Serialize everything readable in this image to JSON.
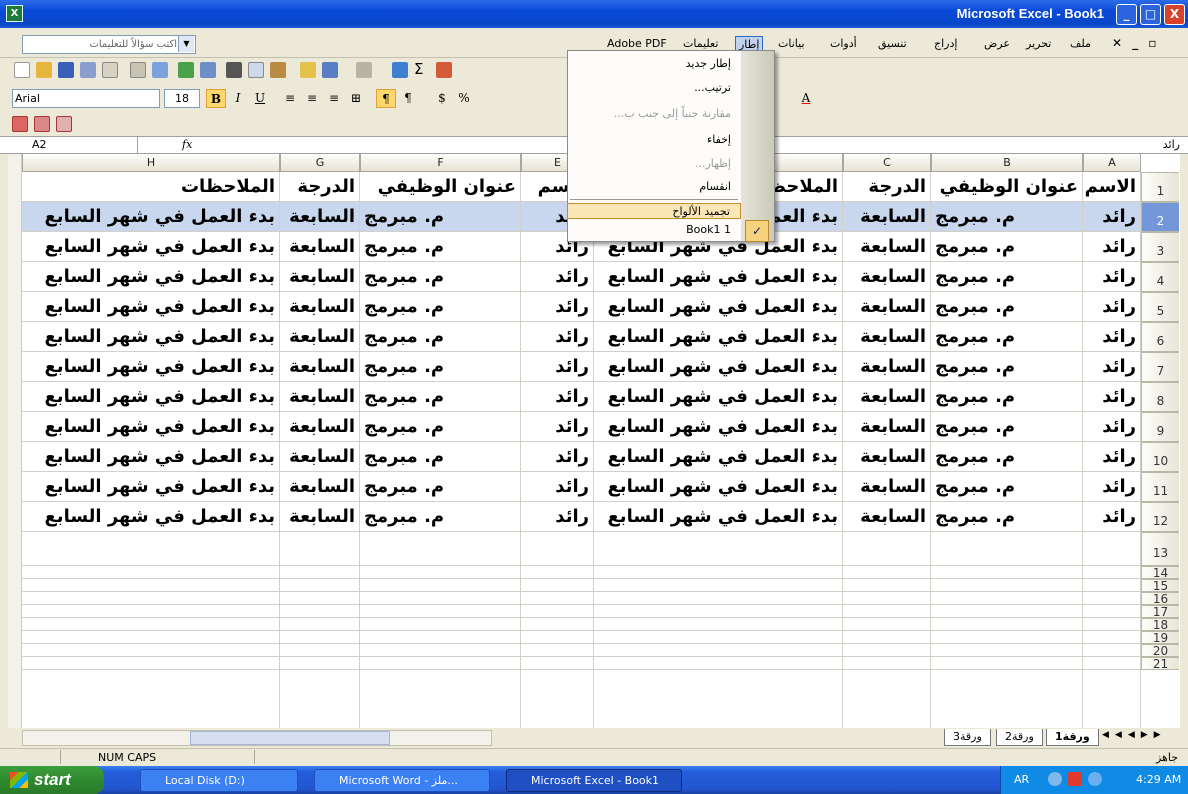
{
  "window": {
    "title": "Microsoft Excel - Book1",
    "app_icon": "excel-icon",
    "buttons": {
      "minimize": "_",
      "maximize": "□",
      "close": "X"
    }
  },
  "menubar": {
    "help_placeholder": "اكتب سؤالاً للتعليمات",
    "items": [
      "ملف",
      "تحرير",
      "عرض",
      "إدراج",
      "تنسيق",
      "أدوات",
      "بيانات",
      "إطار",
      "تعليمات",
      "Adobe PDF"
    ],
    "active_item": "إطار",
    "mdi_controls": "✕ _ ▫"
  },
  "toolbar": {
    "font_name": "Arial",
    "font_size": "18",
    "bold": "B",
    "italic": "I",
    "underline": "U",
    "currency": "$",
    "percent": "%"
  },
  "formula_bar": {
    "name_box": "A2",
    "fx": "fx",
    "value": "رائد"
  },
  "columns": [
    "A",
    "B",
    "C",
    "D",
    "E",
    "F",
    "G",
    "H"
  ],
  "rows": [
    "1",
    "2",
    "3",
    "4",
    "5",
    "6",
    "7",
    "8",
    "9",
    "10",
    "11",
    "12",
    "13",
    "14",
    "15",
    "16",
    "17",
    "18",
    "19",
    "20",
    "21"
  ],
  "headers_row": {
    "a": "الاسم",
    "b": "عنوان الوظيفي",
    "c": "الدرجة",
    "d": "الملاحظات",
    "e": "الاسم",
    "f": "عنوان الوظيفي",
    "g": "الدرجة",
    "h": "الملاحظات"
  },
  "data_row": {
    "name": "رائد",
    "title": "م. مبرمج",
    "grade": "السابعة",
    "notes": "بدء العمل في شهر السابع"
  },
  "data_row_count": 11,
  "sheet_tabs": [
    "ورقة1",
    "ورقة2",
    "ورقة3"
  ],
  "active_sheet": "ورقة1",
  "status": {
    "ready": "جاهز",
    "keys": "NUM CAPS"
  },
  "taskbar": {
    "start": "start",
    "buttons": [
      "Local Disk (D:)",
      "Microsoft Word - ملز...",
      "Microsoft Excel - Book1"
    ],
    "active": "Microsoft Excel - Book1",
    "lang": "AR",
    "time": "4:29 AM"
  },
  "dropdown": {
    "items": [
      {
        "label": "إطار جديد",
        "enabled": true
      },
      {
        "label": "ترتيب...",
        "enabled": true
      },
      {
        "label": "مقارنة جنباً إلى جنب ب...",
        "enabled": false
      },
      {
        "label": "إخفاء",
        "enabled": true
      },
      {
        "label": "إظهار...",
        "enabled": false
      },
      {
        "label": "انقسام",
        "enabled": true
      },
      {
        "label": "تجميد الألواح",
        "enabled": true,
        "highlighted": true
      },
      {
        "label": "Book1 1",
        "enabled": true,
        "checked": true
      }
    ]
  },
  "colors": {
    "title_bar": "#0a49d8",
    "selection": "#c9d7ee",
    "highlight": "#fbe6b6",
    "taskbar": "#245edb",
    "start": "#2f8a2f"
  }
}
